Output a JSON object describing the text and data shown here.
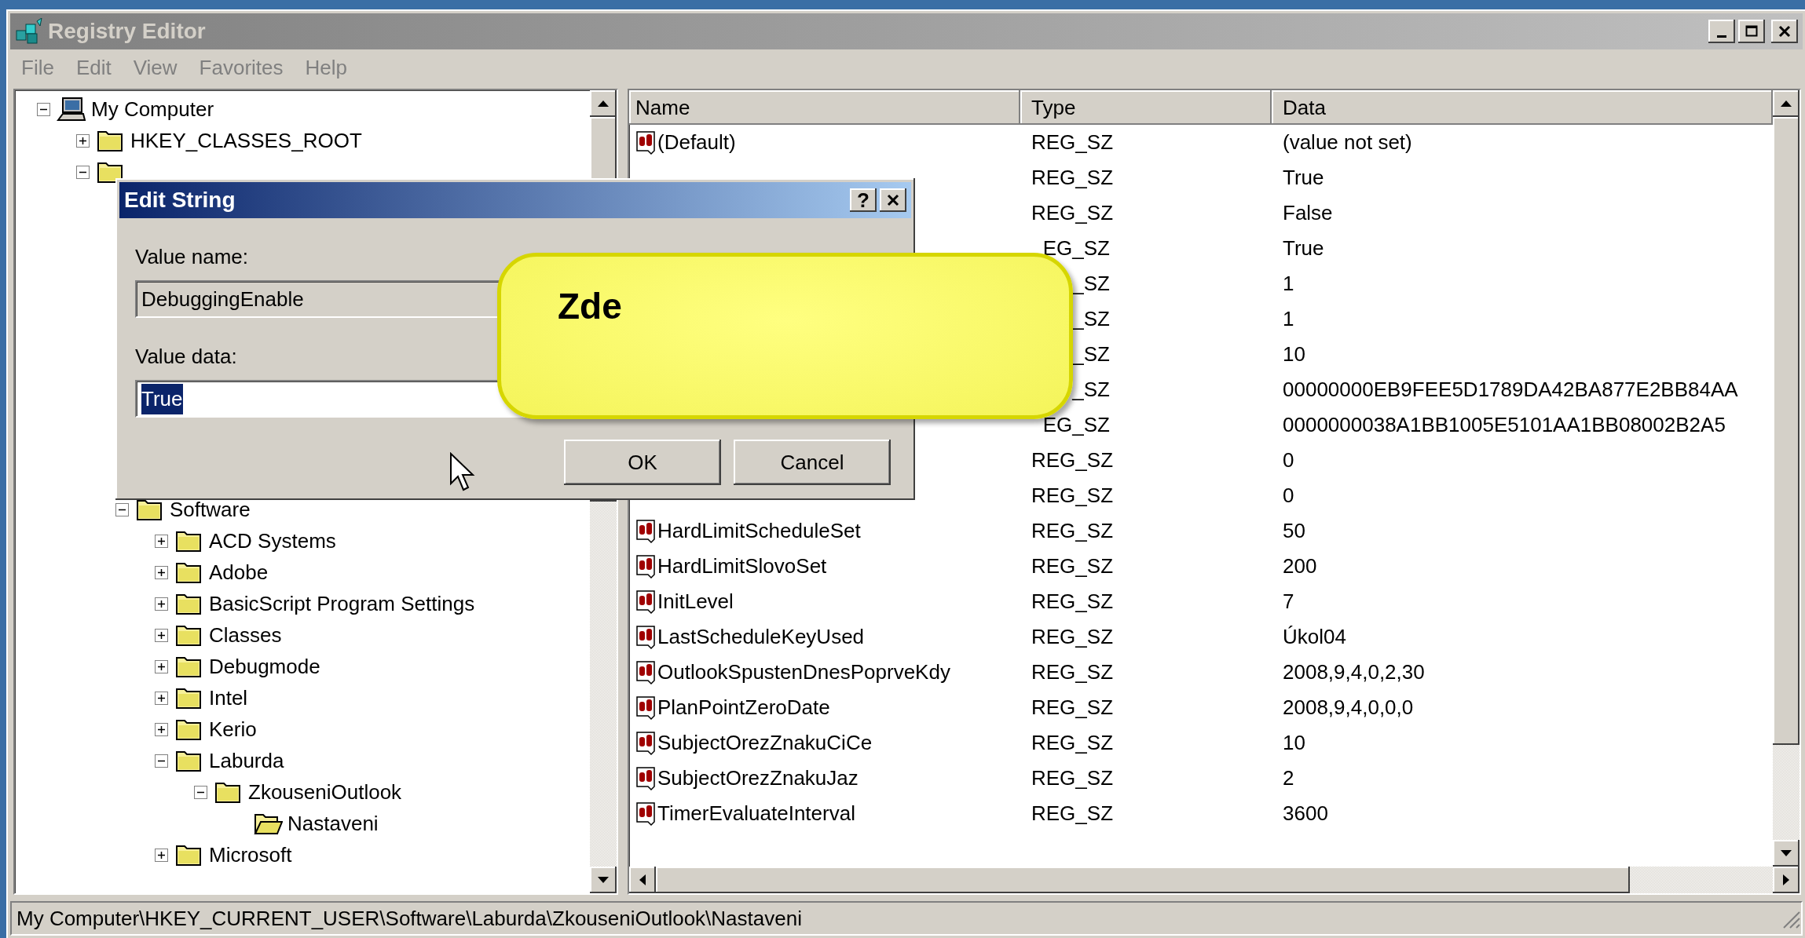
{
  "window": {
    "title": "Registry Editor"
  },
  "menu": [
    "File",
    "Edit",
    "View",
    "Favorites",
    "Help"
  ],
  "tree": [
    {
      "label": "My Computer",
      "kind": "computer",
      "expanded": true,
      "children": [
        {
          "label": "HKEY_CLASSES_ROOT",
          "kind": "folder",
          "expanded": false
        },
        {
          "kind": "folder",
          "expanded": true,
          "children": [
            {
              "label": "Software",
              "kind": "folder",
              "expanded": true,
              "children": [
                {
                  "label": "ACD Systems",
                  "kind": "folder",
                  "expanded": false
                },
                {
                  "label": "Adobe",
                  "kind": "folder",
                  "expanded": false
                },
                {
                  "label": "BasicScript Program Settings",
                  "kind": "folder",
                  "expanded": false
                },
                {
                  "label": "Classes",
                  "kind": "folder",
                  "expanded": false
                },
                {
                  "label": "Debugmode",
                  "kind": "folder",
                  "expanded": false
                },
                {
                  "label": "Intel",
                  "kind": "folder",
                  "expanded": false
                },
                {
                  "label": "Kerio",
                  "kind": "folder",
                  "expanded": false
                },
                {
                  "label": "Laburda",
                  "kind": "folder",
                  "expanded": true,
                  "children": [
                    {
                      "label": "ZkouseniOutlook",
                      "kind": "folder",
                      "expanded": true,
                      "children": [
                        {
                          "label": "Nastaveni",
                          "kind": "open-folder"
                        }
                      ]
                    }
                  ]
                },
                {
                  "label": "Microsoft",
                  "kind": "folder",
                  "expanded": false
                }
              ]
            }
          ]
        }
      ]
    }
  ],
  "table": {
    "columns": [
      "Name",
      "Type",
      "Data"
    ],
    "rows": [
      {
        "name": "(Default)",
        "type": "REG_SZ",
        "data": "(value not set)"
      },
      {
        "type": "REG_SZ",
        "data": "True"
      },
      {
        "type": "REG_SZ",
        "data": "False"
      },
      {
        "type": "EG_SZ",
        "data": "True"
      },
      {
        "type": "_SZ",
        "data": "1"
      },
      {
        "type": "_SZ",
        "data": "1"
      },
      {
        "type": "_SZ",
        "data": "10"
      },
      {
        "type": "_SZ",
        "data": "00000000EB9FEE5D1789DA42BA877E2BB84AA"
      },
      {
        "type": "EG_SZ",
        "data": "0000000038A1BB1005E5101AA1BB08002B2A5"
      },
      {
        "type": "REG_SZ",
        "data": "0"
      },
      {
        "type": "REG_SZ",
        "data": "0"
      },
      {
        "name": "HardLimitScheduleSet",
        "type": "REG_SZ",
        "data": "50"
      },
      {
        "name": "HardLimitSlovoSet",
        "type": "REG_SZ",
        "data": "200"
      },
      {
        "name": "InitLevel",
        "type": "REG_SZ",
        "data": "7"
      },
      {
        "name": "LastScheduleKeyUsed",
        "type": "REG_SZ",
        "data": "Úkol04"
      },
      {
        "name": "OutlookSpustenDnesPoprveKdy",
        "type": "REG_SZ",
        "data": "2008,9,4,0,2,30"
      },
      {
        "name": "PlanPointZeroDate",
        "type": "REG_SZ",
        "data": "2008,9,4,0,0,0"
      },
      {
        "name": "SubjectOrezZnakuCiCe",
        "type": "REG_SZ",
        "data": "10"
      },
      {
        "name": "SubjectOrezZnakuJaz",
        "type": "REG_SZ",
        "data": "2"
      },
      {
        "name": "TimerEvaluateInterval",
        "type": "REG_SZ",
        "data": "3600"
      }
    ]
  },
  "status_bar": "My Computer\\HKEY_CURRENT_USER\\Software\\Laburda\\ZkouseniOutlook\\Nastaveni",
  "dialog": {
    "title": "Edit String",
    "help": "?",
    "value_name_label": "Value name:",
    "value_name": "DebuggingEnable",
    "value_data_label": "Value data:",
    "value_data": "True",
    "buttons": [
      "OK",
      "Cancel"
    ]
  },
  "callout": {
    "text": "Zde"
  }
}
